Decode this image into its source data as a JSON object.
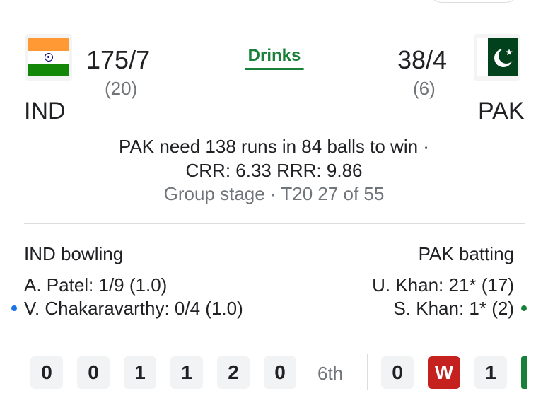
{
  "match": {
    "status": "Drinks",
    "summary": "PAK need 138 runs in 84 balls to win ·",
    "rates": "CRR: 6.33 RRR: 9.86",
    "stage": "Group stage · T20 27 of 55"
  },
  "team1": {
    "abbr": "IND",
    "score": "175/7",
    "overs": "(20)"
  },
  "team2": {
    "abbr": "PAK",
    "score": "38/4",
    "overs": "(6)"
  },
  "bowling": {
    "title": "IND bowling",
    "players": [
      "A. Patel: 1/9 (1.0)",
      "V. Chakaravarthy: 0/4 (1.0)"
    ]
  },
  "batting": {
    "title": "PAK batting",
    "players": [
      "U. Khan: 21* (17)",
      "S. Khan: 1* (2)"
    ]
  },
  "timeline": {
    "balls_before": [
      "0",
      "0",
      "1",
      "1",
      "2",
      "0"
    ],
    "over_label": "6th",
    "balls_after": [
      "0",
      "W",
      "1"
    ]
  },
  "colors": {
    "accent_green": "#188038",
    "wicket_red": "#c5221f",
    "strike_dot_blue": "#1a73e8"
  },
  "icons": {
    "team1_flag": "india-flag-icon",
    "team2_flag": "pakistan-flag-icon"
  }
}
